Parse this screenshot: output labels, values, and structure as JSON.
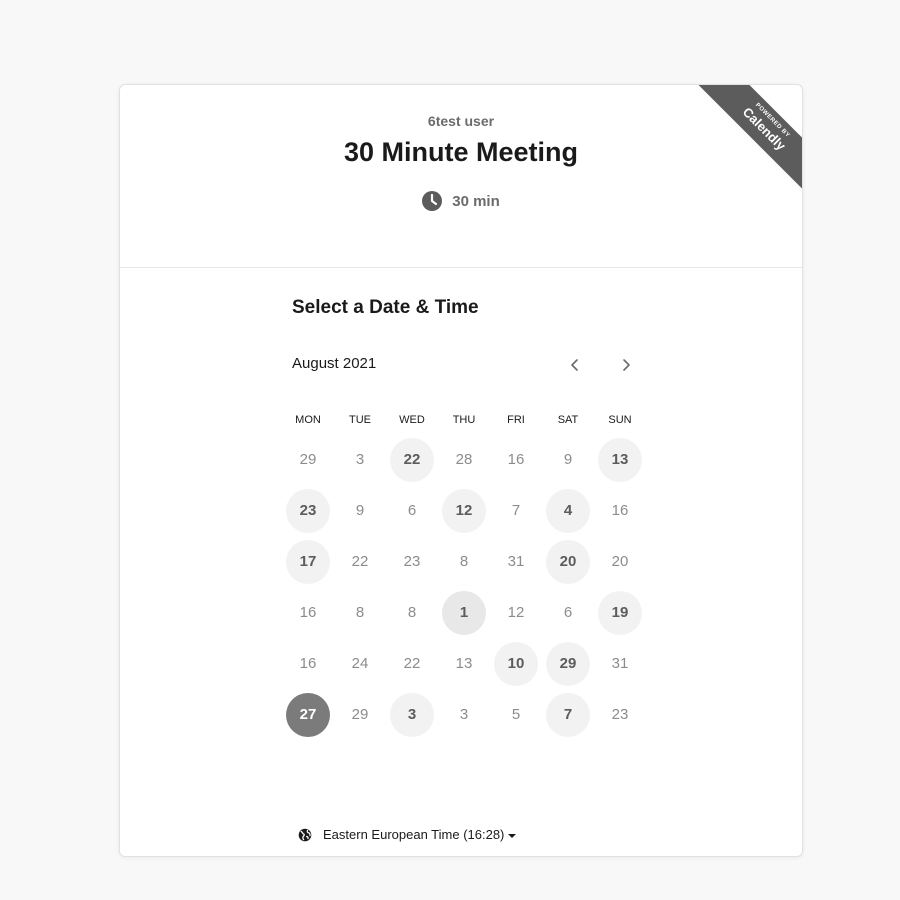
{
  "header": {
    "host_name": "6test user",
    "event_title": "30 Minute Meeting",
    "duration": "30 min",
    "duration_icon": "clock-icon"
  },
  "ribbon": {
    "small_text": "POWERED BY",
    "brand": "Calendly"
  },
  "scheduler": {
    "section_title": "Select a Date & Time",
    "month_label": "August 2021",
    "prev_icon": "chevron-left-icon",
    "next_icon": "chevron-right-icon",
    "weekdays": [
      "MON",
      "TUE",
      "WED",
      "THU",
      "FRI",
      "SAT",
      "SUN"
    ],
    "weeks": [
      [
        {
          "d": "29"
        },
        {
          "d": "3"
        },
        {
          "d": "22",
          "available": true
        },
        {
          "d": "28"
        },
        {
          "d": "16"
        },
        {
          "d": "9"
        },
        {
          "d": "13",
          "available": true
        }
      ],
      [
        {
          "d": "23",
          "available": true
        },
        {
          "d": "9"
        },
        {
          "d": "6"
        },
        {
          "d": "12",
          "available": true
        },
        {
          "d": "7"
        },
        {
          "d": "4",
          "available": true
        },
        {
          "d": "16"
        }
      ],
      [
        {
          "d": "17",
          "available": true
        },
        {
          "d": "22"
        },
        {
          "d": "23"
        },
        {
          "d": "8"
        },
        {
          "d": "31"
        },
        {
          "d": "20",
          "available": true
        },
        {
          "d": "20"
        }
      ],
      [
        {
          "d": "16"
        },
        {
          "d": "8"
        },
        {
          "d": "8"
        },
        {
          "d": "1",
          "available": true,
          "hover": true
        },
        {
          "d": "12"
        },
        {
          "d": "6"
        },
        {
          "d": "19",
          "available": true
        }
      ],
      [
        {
          "d": "16"
        },
        {
          "d": "24"
        },
        {
          "d": "22"
        },
        {
          "d": "13"
        },
        {
          "d": "10",
          "available": true
        },
        {
          "d": "29",
          "available": true
        },
        {
          "d": "31"
        }
      ],
      [
        {
          "d": "27",
          "selected": true
        },
        {
          "d": "29"
        },
        {
          "d": "3",
          "available": true
        },
        {
          "d": "3"
        },
        {
          "d": "5"
        },
        {
          "d": "7",
          "available": true
        },
        {
          "d": "23"
        }
      ]
    ],
    "timezone": {
      "icon": "globe-icon",
      "label": "Eastern European Time (16:28)"
    }
  },
  "colors": {
    "background": "#f8f8f8",
    "card": "#ffffff",
    "ribbon": "#5c5c5c",
    "available_bg": "#f2f2f2",
    "selected_bg": "#7b7b7b",
    "muted_text": "#8c8c8c"
  }
}
